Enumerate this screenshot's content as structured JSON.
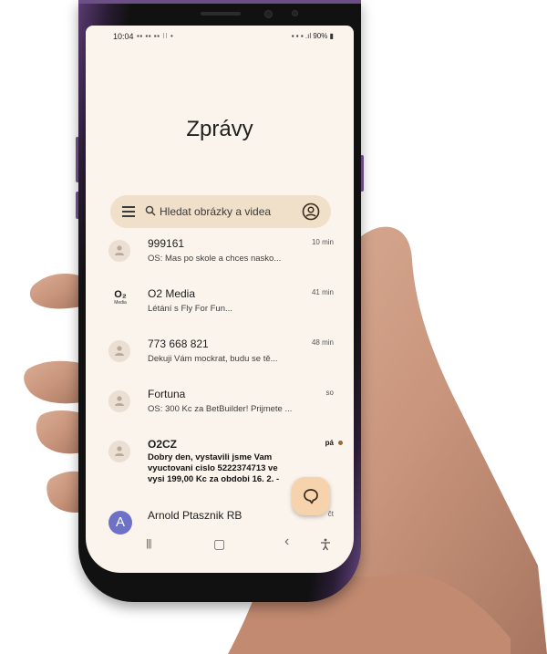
{
  "status_bar": {
    "time": "10:04",
    "left_icons": "▪▪ ▪▪ ▪▪ ⁝⁝ •",
    "right_icons": "▪ ▪ ▪ .ıl",
    "battery": "90%"
  },
  "app": {
    "title": "Zprávy"
  },
  "search": {
    "menu_icon": "menu-icon",
    "search_icon": "search-icon",
    "placeholder": "Hledat obrázky a videa",
    "account_icon": "account-icon"
  },
  "conversations": [
    {
      "name": "999161",
      "preview": "OS: Mas po skole a chces nasko...",
      "time": "10 min",
      "avatar": "person-icon"
    },
    {
      "name": "O2 Media",
      "preview": "Létání s Fly For Fun...",
      "time": "41 min",
      "avatar": "O₂",
      "avatar_sub": "Media"
    },
    {
      "name": "773 668 821",
      "preview": "Dekuji Vám mockrat, budu se tě...",
      "time": "48 min",
      "avatar": "person-icon"
    },
    {
      "name": "Fortuna",
      "preview": "OS: 300 Kc za BetBuilder! Prijmete ...",
      "time": "so",
      "avatar": "person-icon"
    },
    {
      "name": "O2CZ",
      "preview_lines": [
        "Dobry den, vystavili jsme Vam",
        "vyuctovani cislo 5222374713 ve",
        "vysi 199,00 Kc za obdobi 16. 2. -"
      ],
      "time": "pá",
      "unread": true,
      "unread_color": "#9a6a2e",
      "avatar": "person-icon"
    },
    {
      "name": "Arnold Ptasznik RB",
      "time": "čt",
      "avatar": "A",
      "avatar_color": "#6d72c7"
    }
  ],
  "fab": {
    "icon": "chat-bubble-icon",
    "color": "#f6d3ad"
  },
  "nav_bar": {
    "recents": "|||",
    "home": "▢",
    "back": "‹",
    "accessibility": "accessibility-icon"
  },
  "colors": {
    "screen_bg": "#fbf4ec",
    "search_bg": "#f0dfc9",
    "phone_frame": "#6c4f86"
  }
}
